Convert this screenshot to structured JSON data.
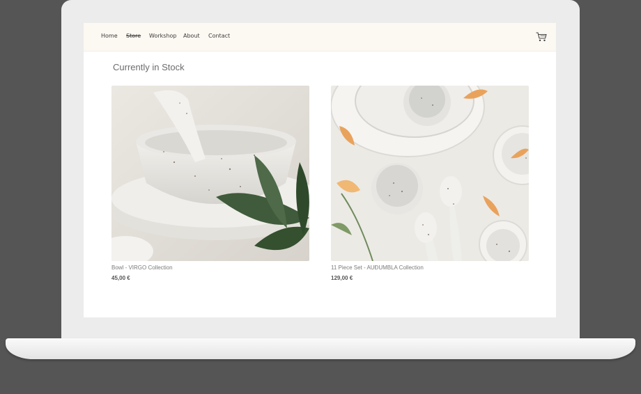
{
  "nav": {
    "items": [
      {
        "label": "Home"
      },
      {
        "label": "Store",
        "active": true
      },
      {
        "label": "Workshop"
      },
      {
        "label": "About"
      },
      {
        "label": "Contact"
      }
    ],
    "cart_icon": "shopping-cart-icon"
  },
  "main": {
    "heading": "Currently in Stock",
    "products": [
      {
        "name": "Bowl - VIRGO Collection",
        "price": "45,00 €",
        "image": "speckled-bowl-photo"
      },
      {
        "name": "11 Piece Set - AUÐUMBLA Collection",
        "price": "129,00 €",
        "image": "speckled-dinnerware-set-photo"
      }
    ]
  },
  "colors": {
    "navbar_bg": "#fcf8f2",
    "page_bg": "#ffffff",
    "device_frame": "#ececec",
    "text": "#3a3a3a"
  }
}
